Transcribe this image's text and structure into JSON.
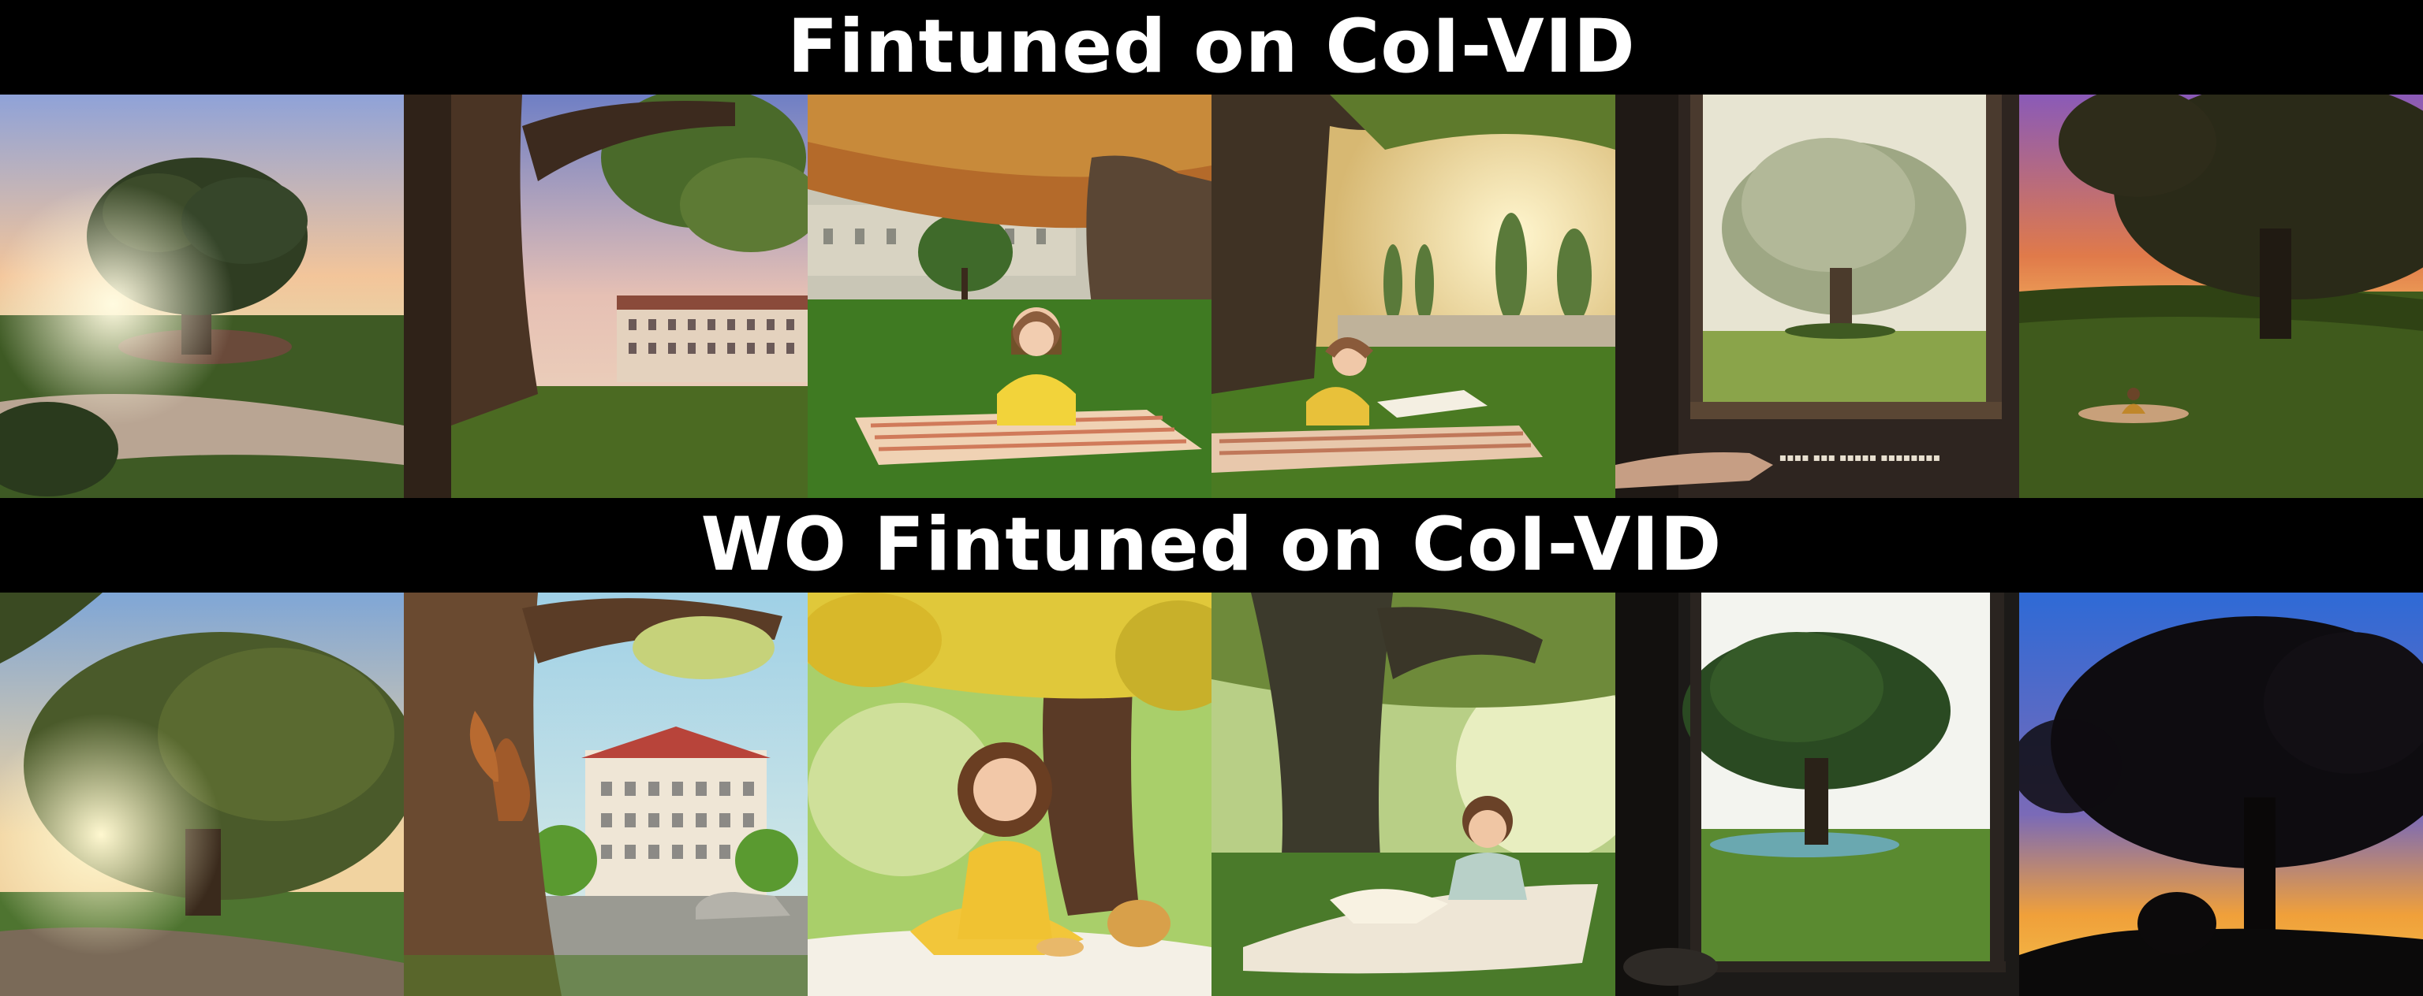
{
  "sections": [
    {
      "title": "Fintuned on CoI-VID",
      "frames": 6
    },
    {
      "title": "WO Fintuned on CoI-VID",
      "frames": 6
    }
  ],
  "frame_text": {
    "top_frame_5_caption": "▪▪▪▪ ▪▪▪ ▪▪▪▪▪ ▪▪▪▪▪▪▪▪"
  }
}
